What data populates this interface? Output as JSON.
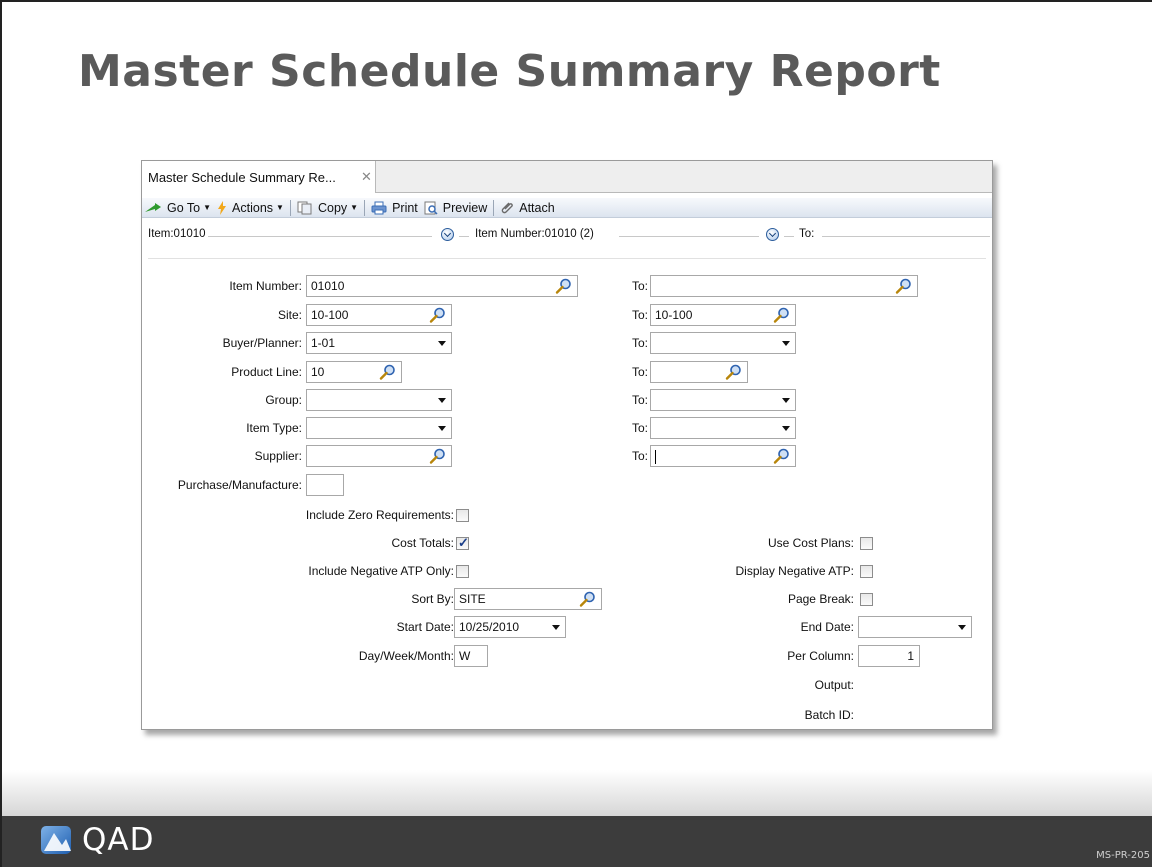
{
  "slide": {
    "title": "Master Schedule Summary Report",
    "logo_text": "QAD",
    "code": "MS-PR-205"
  },
  "window": {
    "tab_label": "Master Schedule Summary Re...",
    "tab_close": "✕",
    "toolbar": {
      "goto": "Go To",
      "actions": "Actions",
      "copy": "Copy",
      "print": "Print",
      "preview": "Preview",
      "attach": "Attach"
    },
    "breadcrumb": {
      "item": "Item:01010",
      "item_number": "Item Number:01010 (2)",
      "to": "To:"
    }
  },
  "form": {
    "item_number": {
      "label": "Item Number:",
      "value": "01010",
      "to_label": "To:",
      "to_value": ""
    },
    "site": {
      "label": "Site:",
      "value": "10-100",
      "to_label": "To:",
      "to_value": "10-100"
    },
    "buyer_planner": {
      "label": "Buyer/Planner:",
      "value": "1-01",
      "to_label": "To:",
      "to_value": ""
    },
    "product_line": {
      "label": "Product Line:",
      "value": "10",
      "to_label": "To:",
      "to_value": ""
    },
    "group": {
      "label": "Group:",
      "value": "",
      "to_label": "To:",
      "to_value": ""
    },
    "item_type": {
      "label": "Item Type:",
      "value": "",
      "to_label": "To:",
      "to_value": ""
    },
    "supplier": {
      "label": "Supplier:",
      "value": "",
      "to_label": "To:",
      "to_value": ""
    },
    "purchase_manufacture": {
      "label": "Purchase/Manufacture:",
      "value": ""
    },
    "include_zero_requirements": {
      "label": "Include Zero Requirements:",
      "checked": false
    },
    "cost_totals": {
      "label": "Cost Totals:",
      "checked": true
    },
    "include_negative_atp_only": {
      "label": "Include Negative ATP Only:",
      "checked": false
    },
    "sort_by": {
      "label": "Sort By:",
      "value": "SITE"
    },
    "start_date": {
      "label": "Start Date:",
      "value": "10/25/2010"
    },
    "day_week_month": {
      "label": "Day/Week/Month:",
      "value": "W"
    },
    "use_cost_plans": {
      "label": "Use Cost Plans:",
      "checked": false
    },
    "display_negative_atp": {
      "label": "Display Negative ATP:",
      "checked": false
    },
    "page_break": {
      "label": "Page Break:",
      "checked": false
    },
    "end_date": {
      "label": "End Date:",
      "value": ""
    },
    "per_column": {
      "label": "Per Column:",
      "value": "1"
    },
    "output": {
      "label": "Output:"
    },
    "batch_id": {
      "label": "Batch ID:"
    }
  }
}
